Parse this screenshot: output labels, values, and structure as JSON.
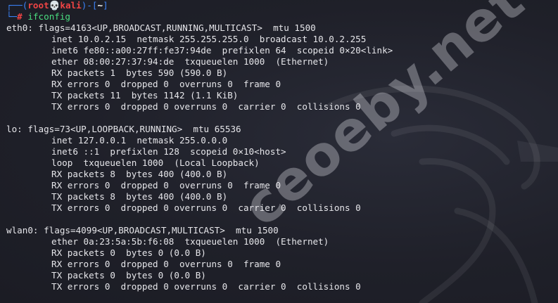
{
  "prompt": {
    "corner_top": "┌──(",
    "user": "root",
    "skull": "💀",
    "host": "kali",
    "mid": ")-[",
    "path": "~",
    "end": "]",
    "corner_bottom": "└─",
    "hash": "#",
    "command": "ifconfig"
  },
  "interfaces": [
    {
      "header": "eth0: flags=4163<UP,BROADCAST,RUNNING,MULTICAST>  mtu 1500",
      "lines": [
        "inet 10.0.2.15  netmask 255.255.255.0  broadcast 10.0.2.255",
        "inet6 fe80::a00:27ff:fe37:94de  prefixlen 64  scopeid 0×20<link>",
        "ether 08:00:27:37:94:de  txqueuelen 1000  (Ethernet)",
        "RX packets 1  bytes 590 (590.0 B)",
        "RX errors 0  dropped 0  overruns 0  frame 0",
        "TX packets 11  bytes 1142 (1.1 KiB)",
        "TX errors 0  dropped 0 overruns 0  carrier 0  collisions 0"
      ]
    },
    {
      "header": "lo: flags=73<UP,LOOPBACK,RUNNING>  mtu 65536",
      "lines": [
        "inet 127.0.0.1  netmask 255.0.0.0",
        "inet6 ::1  prefixlen 128  scopeid 0×10<host>",
        "loop  txqueuelen 1000  (Local Loopback)",
        "RX packets 8  bytes 400 (400.0 B)",
        "RX errors 0  dropped 0  overruns 0  frame 0",
        "TX packets 8  bytes 400 (400.0 B)",
        "TX errors 0  dropped 0 overruns 0  carrier 0  collisions 0"
      ]
    },
    {
      "header": "wlan0: flags=4099<UP,BROADCAST,MULTICAST>  mtu 1500",
      "lines": [
        "ether 0a:23:5a:5b:f6:08  txqueuelen 1000  (Ethernet)",
        "RX packets 0  bytes 0 (0.0 B)",
        "RX errors 0  dropped 0  overruns 0  frame 0",
        "TX packets 0  bytes 0 (0.0 B)",
        "TX errors 0  dropped 0 overruns 0  carrier 0  collisions 0"
      ]
    }
  ],
  "watermark": "ceoeby.net",
  "colors": {
    "background": "#1e1f29",
    "prompt_frame": "#3b82f6",
    "prompt_user": "#ef4444",
    "command": "#4ade80",
    "text": "#e6e6ea"
  },
  "icons": {
    "background": "kali-dragon-icon",
    "skull": "skull-icon"
  }
}
